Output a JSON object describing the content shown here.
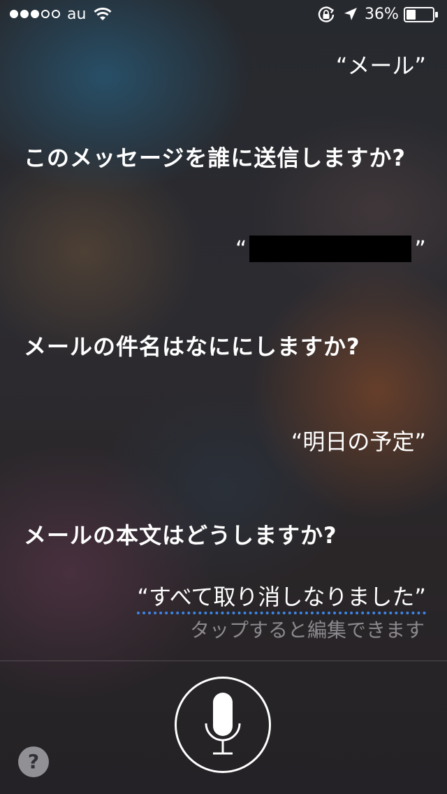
{
  "status_bar": {
    "carrier": "au",
    "battery_percent": "36%",
    "signal_bars_filled": 3,
    "signal_bars_total": 5,
    "battery_level": 0.36,
    "icons": [
      "wifi-icon",
      "orientation-lock-icon",
      "location-arrow-icon",
      "battery-icon"
    ]
  },
  "conversation": {
    "user_1": "“メール”",
    "siri_1": "このメッセージを誰に送信しますか?",
    "user_2_open": "“",
    "user_2_close": "”",
    "siri_2": "メールの件名はなににしますか?",
    "user_3": "“明日の予定”",
    "siri_3": "メールの本文はどうしますか?",
    "user_4": "“すべて取り消しなりました”",
    "tap_hint": "タップすると編集できます"
  },
  "controls": {
    "help_label": "?",
    "mic_icon": "microphone-icon"
  },
  "colors": {
    "accent_dotted_underline": "#3d86e6",
    "text": "#ffffff",
    "hint": "#dcdce1"
  }
}
